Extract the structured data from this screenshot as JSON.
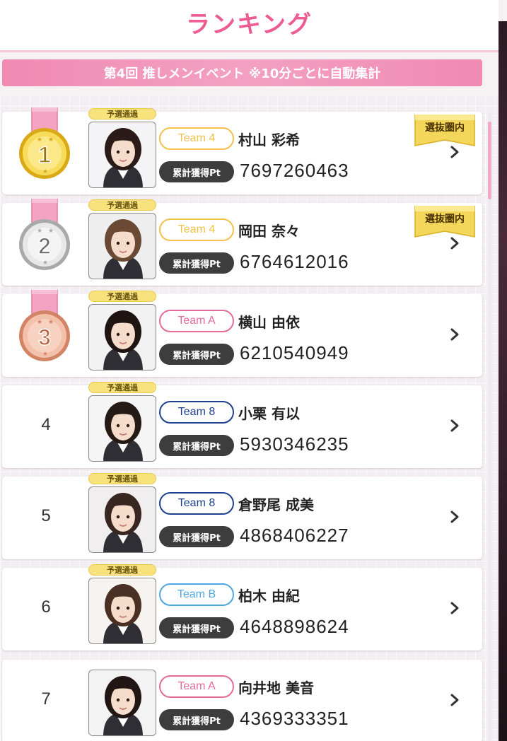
{
  "header": {
    "title": "ランキング"
  },
  "banner": {
    "text": "第4回 推しメンイベント ※10分ごとに自動集計"
  },
  "labels": {
    "qualified": "予選通過",
    "points_label": "累計獲得Pt",
    "selected_badge": "選抜圏内"
  },
  "colors": {
    "accent_pink": "#ec5b92",
    "team_4": "#f2c14a",
    "team_A": "#e56b9a",
    "team_8": "#1f3f8f",
    "team_B": "#4ea6e0"
  },
  "rankings": [
    {
      "rank": "1",
      "team": "Team 4",
      "name": "村山 彩希",
      "points": "7697260463",
      "qualified": true,
      "selected": true
    },
    {
      "rank": "2",
      "team": "Team 4",
      "name": "岡田 奈々",
      "points": "6764612016",
      "qualified": true,
      "selected": true
    },
    {
      "rank": "3",
      "team": "Team A",
      "name": "横山 由依",
      "points": "6210540949",
      "qualified": true,
      "selected": false
    },
    {
      "rank": "4",
      "team": "Team 8",
      "name": "小栗 有以",
      "points": "5930346235",
      "qualified": true,
      "selected": false
    },
    {
      "rank": "5",
      "team": "Team 8",
      "name": "倉野尾 成美",
      "points": "4868406227",
      "qualified": true,
      "selected": false
    },
    {
      "rank": "6",
      "team": "Team B",
      "name": "柏木 由紀",
      "points": "4648898624",
      "qualified": true,
      "selected": false
    },
    {
      "rank": "7",
      "team": "Team A",
      "name": "向井地 美音",
      "points": "4369333351",
      "qualified": false,
      "selected": false
    }
  ]
}
